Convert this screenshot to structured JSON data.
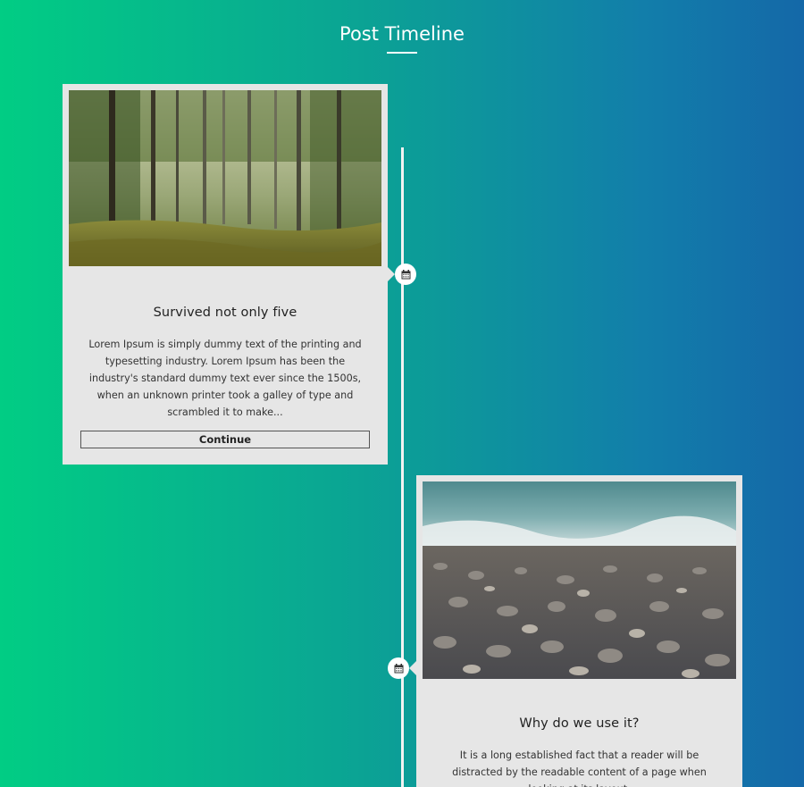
{
  "page": {
    "title": "Post Timeline"
  },
  "posts": [
    {
      "title": "Survived not only five",
      "excerpt": "Lorem Ipsum is simply dummy text of the printing and typesetting industry. Lorem Ipsum has been the industry's standard dummy text ever since the 1500s, when an unknown printer took a galley of type and scrambled it to make...",
      "button_label": "Continue",
      "image": "forest-photo",
      "icon": "calendar-icon"
    },
    {
      "title": "Why do we use it?",
      "excerpt": "It is a long established fact that a reader will be distracted by the readable content of a page when looking at its layout.",
      "image": "pebble-beach-photo",
      "icon": "calendar-icon"
    }
  ],
  "colors": {
    "gradient_start": "#01cd84",
    "gradient_end": "#1468a8",
    "card_bg": "#e6e6e6",
    "line": "#f2f2f2"
  }
}
